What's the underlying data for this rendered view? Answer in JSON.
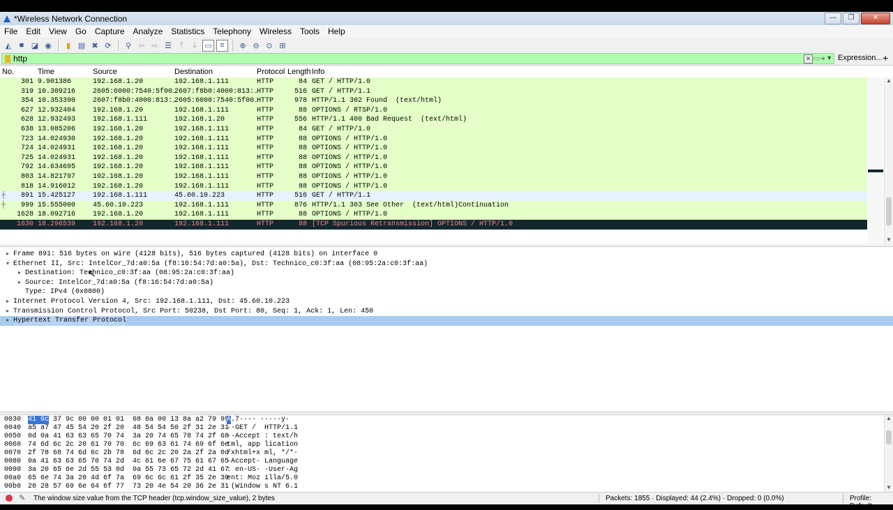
{
  "window": {
    "title": "*Wireless Network Connection",
    "min": "—",
    "max": "❐",
    "close": "✕"
  },
  "menu": [
    "File",
    "Edit",
    "View",
    "Go",
    "Capture",
    "Analyze",
    "Statistics",
    "Telephony",
    "Wireless",
    "Tools",
    "Help"
  ],
  "filter": {
    "value": "http",
    "expression_label": "Expression...",
    "plus": "+"
  },
  "columns": {
    "no": "No.",
    "time": "Time",
    "source": "Source",
    "destination": "Destination",
    "protocol": "Protocol",
    "length": "Length",
    "info": "Info"
  },
  "packets": [
    {
      "no": "301",
      "time": "9.901386",
      "src": "192.168.1.20",
      "dst": "192.168.1.111",
      "proto": "HTTP",
      "len": "84",
      "info": "GET / HTTP/1.0"
    },
    {
      "no": "319",
      "time": "10.309216",
      "src": "2605:6000:7540:5f00…",
      "dst": "2607:f8b0:4000:813:…",
      "proto": "HTTP",
      "len": "516",
      "info": "GET / HTTP/1.1"
    },
    {
      "no": "354",
      "time": "10.353390",
      "src": "2607:f8b0:4000:813:…",
      "dst": "2605:6000:7540:5f00…",
      "proto": "HTTP",
      "len": "978",
      "info": "HTTP/1.1 302 Found  (text/html)"
    },
    {
      "no": "627",
      "time": "12.932404",
      "src": "192.168.1.20",
      "dst": "192.168.1.111",
      "proto": "HTTP",
      "len": "88",
      "info": "OPTIONS / RTSP/1.0"
    },
    {
      "no": "628",
      "time": "12.932493",
      "src": "192.168.1.111",
      "dst": "192.168.1.20",
      "proto": "HTTP",
      "len": "556",
      "info": "HTTP/1.1 400 Bad Request  (text/html)"
    },
    {
      "no": "638",
      "time": "13.085206",
      "src": "192.168.1.20",
      "dst": "192.168.1.111",
      "proto": "HTTP",
      "len": "84",
      "info": "GET / HTTP/1.0"
    },
    {
      "no": "723",
      "time": "14.024930",
      "src": "192.168.1.20",
      "dst": "192.168.1.111",
      "proto": "HTTP",
      "len": "88",
      "info": "OPTIONS / HTTP/1.0"
    },
    {
      "no": "724",
      "time": "14.024931",
      "src": "192.168.1.20",
      "dst": "192.168.1.111",
      "proto": "HTTP",
      "len": "88",
      "info": "OPTIONS / HTTP/1.0"
    },
    {
      "no": "725",
      "time": "14.024931",
      "src": "192.168.1.20",
      "dst": "192.168.1.111",
      "proto": "HTTP",
      "len": "88",
      "info": "OPTIONS / HTTP/1.0"
    },
    {
      "no": "792",
      "time": "14.634695",
      "src": "192.168.1.20",
      "dst": "192.168.1.111",
      "proto": "HTTP",
      "len": "88",
      "info": "OPTIONS / HTTP/1.0"
    },
    {
      "no": "803",
      "time": "14.821797",
      "src": "192.168.1.20",
      "dst": "192.168.1.111",
      "proto": "HTTP",
      "len": "88",
      "info": "OPTIONS / HTTP/1.0"
    },
    {
      "no": "818",
      "time": "14.916012",
      "src": "192.168.1.20",
      "dst": "192.168.1.111",
      "proto": "HTTP",
      "len": "88",
      "info": "OPTIONS / HTTP/1.0"
    },
    {
      "no": "891",
      "time": "15.425127",
      "src": "192.168.1.111",
      "dst": "45.60.10.223",
      "proto": "HTTP",
      "len": "516",
      "info": "GET / HTTP/1.1"
    },
    {
      "no": "999",
      "time": "15.555000",
      "src": "45.60.10.223",
      "dst": "192.168.1.111",
      "proto": "HTTP",
      "len": "876",
      "info": "HTTP/1.1 303 See Other  (text/html)Continuation"
    },
    {
      "no": "1628",
      "time": "18.092716",
      "src": "192.168.1.20",
      "dst": "192.168.1.111",
      "proto": "HTTP",
      "len": "88",
      "info": "OPTIONS / HTTP/1.0"
    },
    {
      "no": "1630",
      "time": "18.296539",
      "src": "192.168.1.20",
      "dst": "192.168.1.111",
      "proto": "HTTP",
      "len": "88",
      "info": "[TCP Spurious Retransmission] OPTIONS / HTTP/1.0"
    }
  ],
  "details": [
    {
      "tw": "▸",
      "text": "Frame 891: 516 bytes on wire (4128 bits), 516 bytes captured (4128 bits) on interface 0"
    },
    {
      "tw": "▾",
      "text": "Ethernet II, Src: IntelCor_7d:a0:5a (f8:16:54:7d:a0:5a), Dst: Technico_c0:3f:aa (08:95:2a:c0:3f:aa)"
    },
    {
      "tw": "▸",
      "text": "Destination: Technico_c0:3f:aa (08:95:2a:c0:3f:aa)"
    },
    {
      "tw": "▸",
      "text": "Source: IntelCor_7d:a0:5a (f8:16:54:7d:a0:5a)"
    },
    {
      "tw": "",
      "text": "Type: IPv4 (0x0800)"
    },
    {
      "tw": "▸",
      "text": "Internet Protocol Version 4, Src: 192.168.1.111, Dst: 45.60.10.223"
    },
    {
      "tw": "▸",
      "text": "Transmission Control Protocol, Src Port: 50238, Dst Port: 80, Seq: 1, Ack: 1, Len: 450"
    },
    {
      "tw": "▸",
      "text": "Hypertext Transfer Protocol"
    }
  ],
  "hex": [
    {
      "off": "0030",
      "b1": "41 0c",
      "b2": " 37 9c 00 00 01 01  08 0a 00 13 8a a2 79 99",
      "a1": "A",
      "a2": ".7···· ·····y·"
    },
    {
      "off": "0040",
      "b": "a5 a7 47 45 54 20 2f 20  48 54 54 50 2f 31 2e 31",
      "a": "··GET /  HTTP/1.1"
    },
    {
      "off": "0050",
      "b": "0d 0a 41 63 63 65 70 74  3a 20 74 65 78 74 2f 68",
      "a": "··Accept : text/h"
    },
    {
      "off": "0060",
      "b": "74 6d 6c 2c 20 61 70 70  6c 69 63 61 74 69 6f 6e",
      "a": "tml, app lication"
    },
    {
      "off": "0070",
      "b": "2f 78 68 74 6d 6c 2b 78  6d 6c 2c 20 2a 2f 2a 0d",
      "a": "/xhtml+x ml, */*·"
    },
    {
      "off": "0080",
      "b": "0a 41 63 63 65 70 74 2d  4c 61 6e 67 75 61 67 65",
      "a": "·Accept- Language"
    },
    {
      "off": "0090",
      "b": "3a 20 65 6e 2d 55 53 0d  0a 55 73 65 72 2d 41 67",
      "a": ": en-US· ·User-Ag"
    },
    {
      "off": "00a0",
      "b": "65 6e 74 3a 20 4d 6f 7a  69 6c 6c 61 2f 35 2e 30",
      "a": "ent: Moz illa/5.0"
    },
    {
      "off": "00b0",
      "b": "20 28 57 69 6e 64 6f 77  73 20 4e 54 20 36 2e 31",
      "a": " (Window s NT 6.1"
    }
  ],
  "status": {
    "message": "The window size value from the TCP header (tcp.window_size_value), 2 bytes",
    "counts": "Packets: 1855 · Displayed: 44 (2.4%) · Dropped: 0 (0.0%)",
    "profile": "Profile: Default"
  },
  "colors": {
    "http_row": "#e4ffc7",
    "selected_row": "#12272e",
    "selected_fg": "#f78787",
    "filter_ok": "#afffaf",
    "tree_select": "#a8cbef"
  }
}
